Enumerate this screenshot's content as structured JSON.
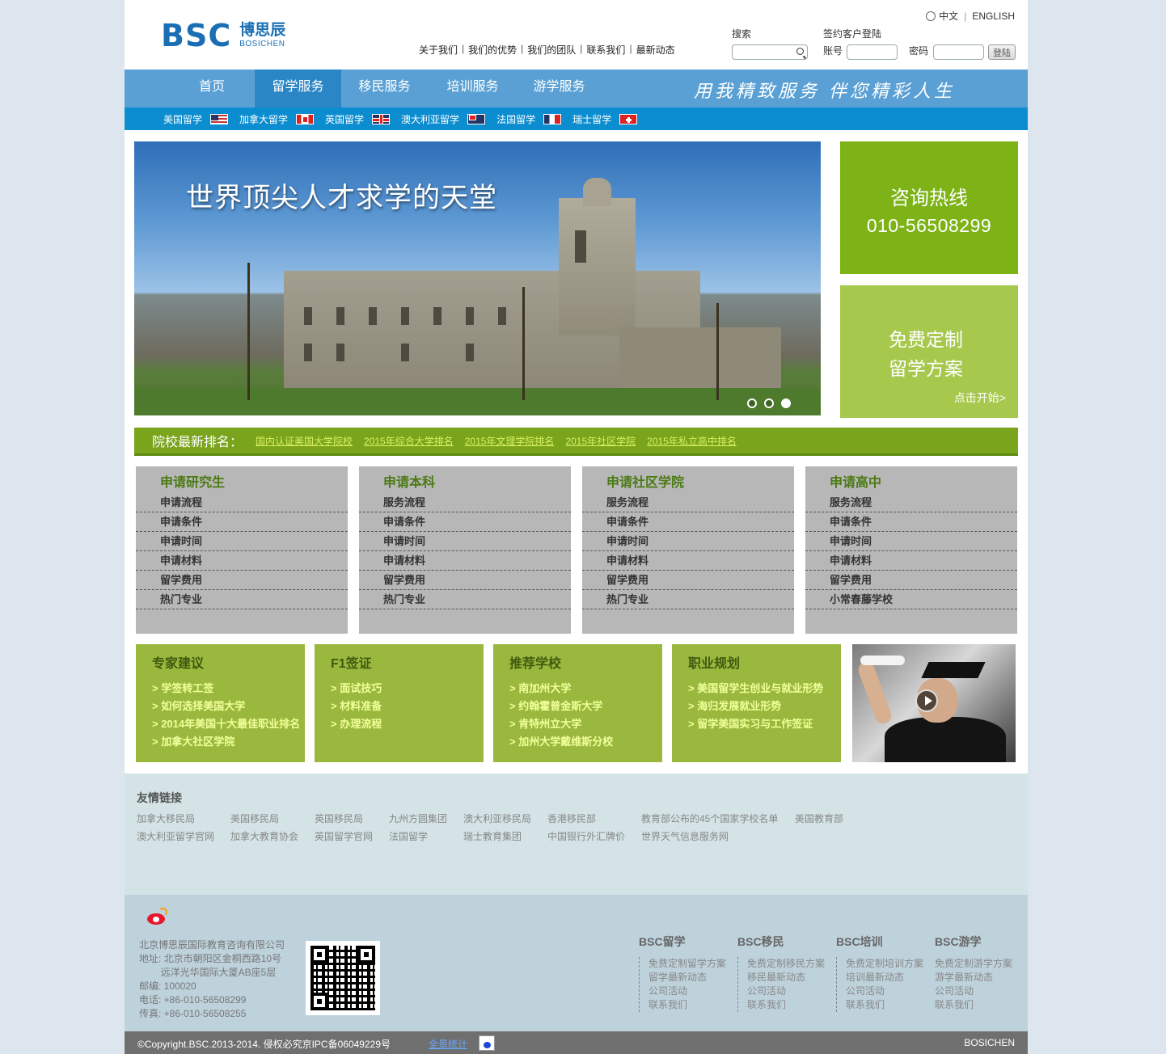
{
  "header": {
    "logo_mark": "BSC",
    "logo_cn": "博思辰",
    "logo_en": "BOSICHEN",
    "lang_cn": "中文",
    "lang_en": "ENGLISH",
    "top_links": [
      "关于我们",
      "我们的优势",
      "我们的团队",
      "联系我们",
      "最新动态"
    ],
    "search_label": "搜索",
    "login_title": "签约客户登陆",
    "account_label": "账号",
    "password_label": "密码",
    "login_button": "登陆"
  },
  "nav": {
    "items": [
      "首页",
      "留学服务",
      "移民服务",
      "培训服务",
      "游学服务"
    ],
    "active_index": 1,
    "slogan": "用我精致服务 伴您精彩人生"
  },
  "subnav": [
    {
      "label": "美国留学",
      "flag": "us-flag-icon"
    },
    {
      "label": "加拿大留学",
      "flag": "canada-flag-icon"
    },
    {
      "label": "英国留学",
      "flag": "uk-flag-icon"
    },
    {
      "label": "澳大利亚留学",
      "flag": "australia-flag-icon"
    },
    {
      "label": "法国留学",
      "flag": "france-flag-icon"
    },
    {
      "label": "瑞士留学",
      "flag": "switzerland-flag-icon"
    }
  ],
  "banner": {
    "title": "世界顶尖人才求学的天堂",
    "slides": 3,
    "active_slide": 3
  },
  "hotline": {
    "title": "咨询热线",
    "number": "010-56508299"
  },
  "custom_plan": {
    "line1": "免费定制",
    "line2": "留学方案",
    "cta": "点击开始>"
  },
  "ranking": {
    "label": "院校最新排名：",
    "links": [
      "国内认证美国大学院校",
      "2015年综合大学排名",
      "2015年文理学院排名",
      "2015年社区学院",
      "2015年私立高中排名"
    ]
  },
  "apply": [
    {
      "title": "申请研究生",
      "items": [
        "申请流程",
        "申请条件",
        "申请时间",
        "申请材料",
        "留学费用",
        "热门专业"
      ]
    },
    {
      "title": "申请本科",
      "items": [
        "服务流程",
        "申请条件",
        "申请时间",
        "申请材料",
        "留学费用",
        "热门专业"
      ]
    },
    {
      "title": "申请社区学院",
      "items": [
        "服务流程",
        "申请条件",
        "申请时间",
        "申请材料",
        "留学费用",
        "热门专业"
      ]
    },
    {
      "title": "申请高中",
      "items": [
        "服务流程",
        "申请条件",
        "申请时间",
        "申请材料",
        "留学费用",
        "小常春藤学校"
      ]
    }
  ],
  "green": [
    {
      "title": "专家建议",
      "items": [
        "> 学签转工签",
        "> 如何选择美国大学",
        "> 2014年美国十大最佳职业排名",
        "> 加拿大社区学院"
      ]
    },
    {
      "title": "F1签证",
      "items": [
        "> 面试技巧",
        "> 材料准备",
        "> 办理流程"
      ]
    },
    {
      "title": "推荐学校",
      "items": [
        "> 南加州大学",
        "> 约翰霍普金斯大学",
        "> 肯特州立大学",
        "> 加州大学戴维斯分校"
      ]
    },
    {
      "title": "职业规划",
      "items": [
        "> 美国留学生创业与就业形势",
        "> 海归发展就业形势",
        "> 留学美国实习与工作签证"
      ]
    }
  ],
  "friends": {
    "title": "友情链接",
    "row1": [
      "加拿大移民局",
      "美国移民局",
      "英国移民局",
      "九州方圆集团",
      "澳大利亚移民局",
      "香港移民部",
      "教育部公布的45个国家学校名单",
      "美国教育部"
    ],
    "row2": [
      "澳大利亚留学官网",
      "加拿大教育协会",
      "英国留学官网",
      "法国留学",
      "瑞士教育集团",
      "中国银行外汇牌价",
      "世界天气信息服务网"
    ]
  },
  "footer": {
    "address_lines": [
      "北京博思辰国际教育咨询有限公司",
      "地址: 北京市朝阳区金桐西路10号",
      "        远洋光华国际大厦AB座5层",
      "邮编: 100020",
      "电话: +86-010-56508299",
      "传真: +86-010-56508255"
    ],
    "columns": [
      {
        "title": "BSC留学",
        "items": [
          "免费定制留学方案",
          "留学最新动态",
          "公司活动",
          "联系我们"
        ]
      },
      {
        "title": "BSC移民",
        "items": [
          "免费定制移民方案",
          "移民最新动态",
          "公司活动",
          "联系我们"
        ]
      },
      {
        "title": "BSC培训",
        "items": [
          "免费定制培训方案",
          "培训最新动态",
          "公司活动",
          "联系我们"
        ]
      },
      {
        "title": "BSC游学",
        "items": [
          "免费定制游学方案",
          "游学最新动态",
          "公司活动",
          "联系我们"
        ]
      }
    ],
    "copyright": "©Copyright.BSC.2013-2014. 侵权必究京IPC备06049229号",
    "stats_link": "全景统计",
    "brand": "BOSICHEN"
  },
  "colors": {
    "nav_blue": "#5aa0d4",
    "nav_active": "#2b86c6",
    "subnav_blue": "#0c8dcf",
    "green_dark": "#7db317",
    "green_light": "#a6c84c",
    "rank_green": "#7aa41c"
  }
}
